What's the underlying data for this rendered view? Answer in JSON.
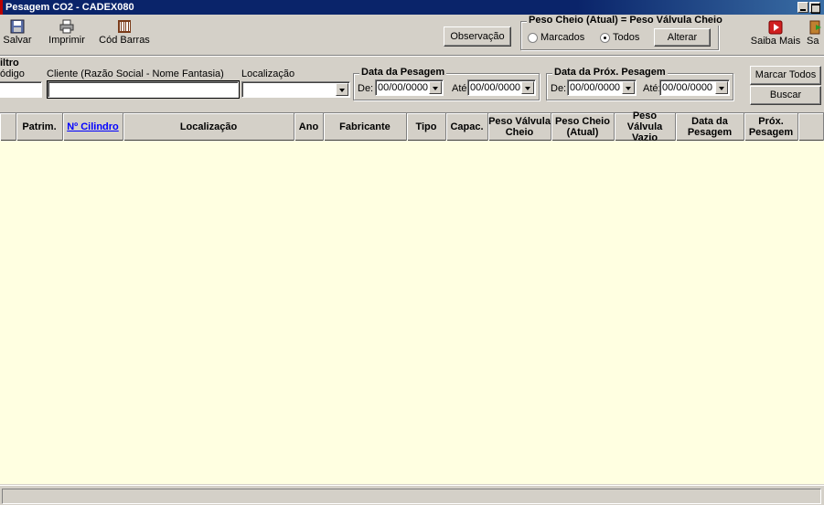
{
  "window": {
    "title": "Pesagem CO2 - CADEX080"
  },
  "toolbar": {
    "salvar": "Salvar",
    "imprimir": "Imprimir",
    "cod_barras": "Cód Barras",
    "saiba_mais": "Saiba Mais",
    "sair_partial": "Sa"
  },
  "observacao_label": "Observação",
  "peso_group": {
    "legend": "Peso Cheio (Atual) = Peso Válvula Cheio",
    "radio_marcados": "Marcados",
    "radio_todos": "Todos",
    "selected": "Todos",
    "alterar": "Alterar"
  },
  "filtro": {
    "legend": "iltro",
    "codigo_label": "ódigo",
    "codigo_value": "",
    "cliente_label": "Cliente (Razão Social - Nome Fantasia)",
    "cliente_value": "",
    "localizacao_label": "Localização",
    "localizacao_value": ""
  },
  "data_pesagem": {
    "legend": "Data da Pesagem",
    "de_label": "De:",
    "de_value": "00/00/0000",
    "ate_label": "Até:",
    "ate_value": "00/00/0000"
  },
  "data_prox": {
    "legend": "Data da Próx. Pesagem",
    "de_label": "De:",
    "de_value": "00/00/0000",
    "ate_label": "Até:",
    "ate_value": "00/00/0000"
  },
  "actions": {
    "marcar_todos": "Marcar Todos",
    "buscar": "Buscar"
  },
  "columns": [
    "Patrim.",
    "Nº Cilindro",
    "Localização",
    "Ano",
    "Fabricante",
    "Tipo",
    "Capac.",
    "Peso Válvula\nCheio",
    "Peso Cheio\n(Atual)",
    "Peso Válvula\nVazio",
    "Data da\nPesagem",
    "Próx.\nPesagem"
  ],
  "rows": [],
  "colors": {
    "title_bar": "#0a246a",
    "grid_background": "#ffffe1",
    "link": "#0000ff",
    "window": "#d4d0c8"
  }
}
